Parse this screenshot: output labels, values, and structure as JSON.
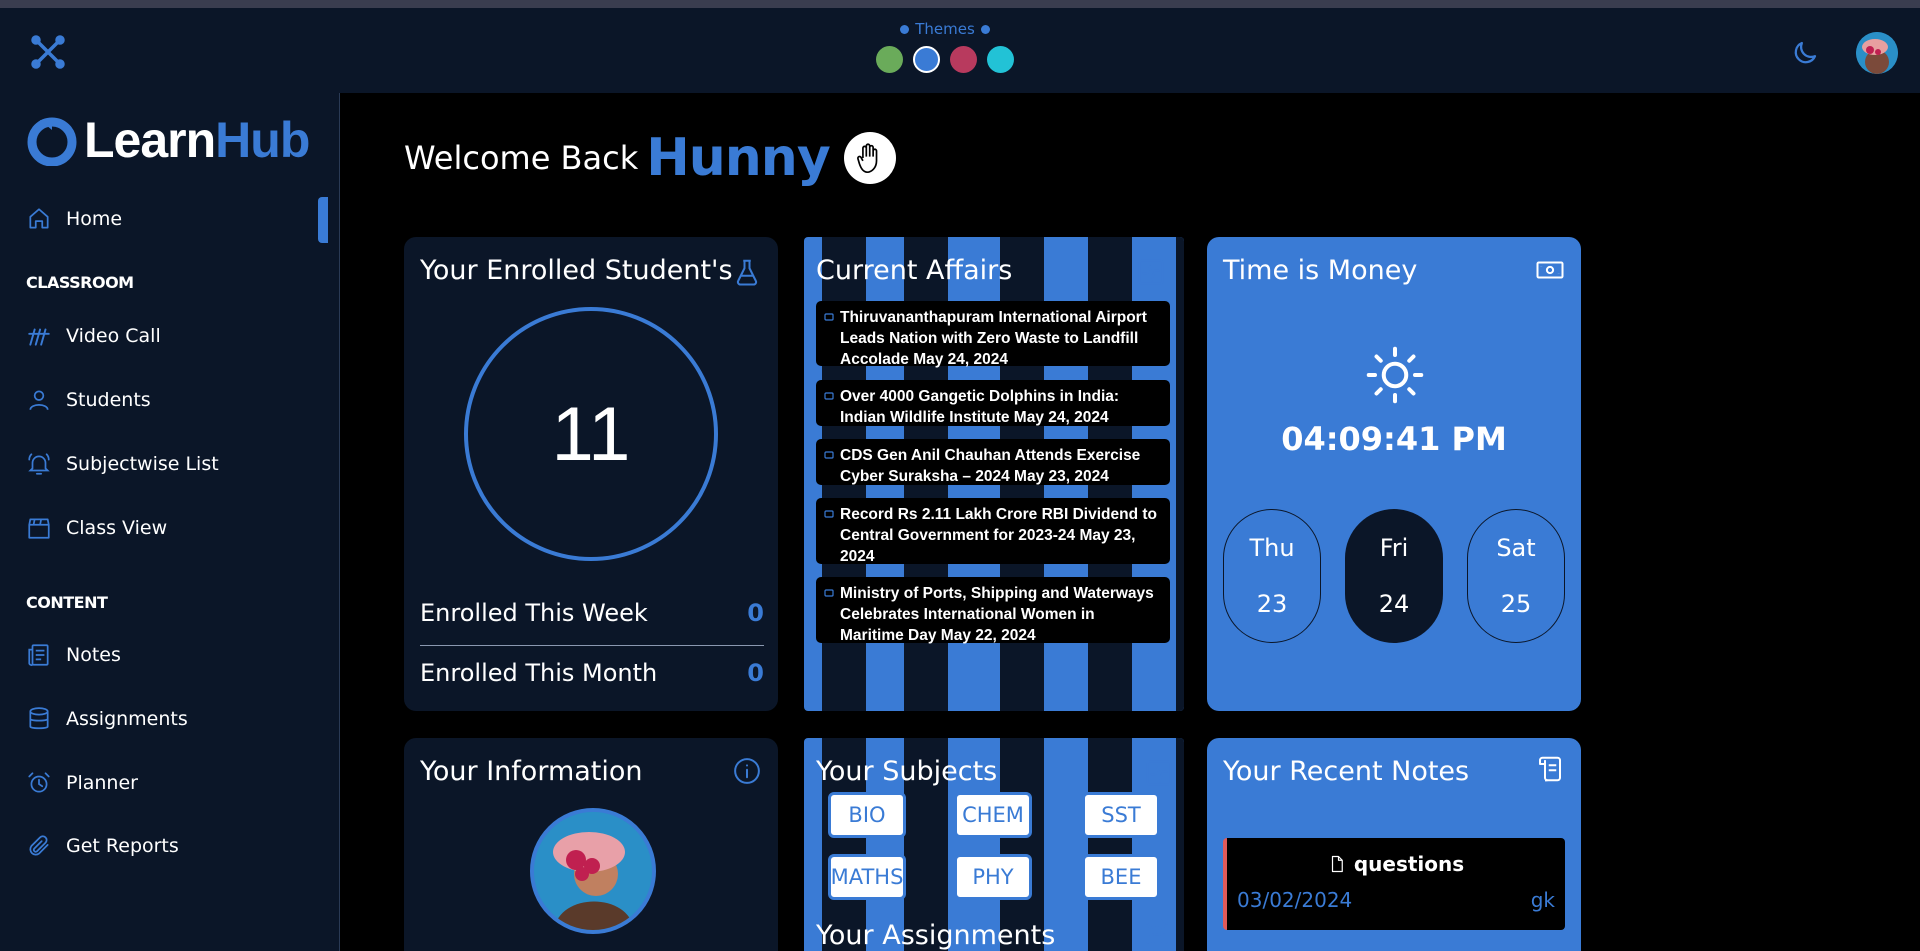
{
  "topbar": {
    "themes_label": "Themes",
    "theme_colors": [
      "#6aab5a",
      "#3a7bd5",
      "#b83a5e",
      "#22c2d6"
    ],
    "active_theme": 1
  },
  "brand": {
    "part1": "Learn",
    "part2": "Hub"
  },
  "sidebar": {
    "home": "Home",
    "classroom_heading": "CLASSROOM",
    "classroom_items": [
      "Video Call",
      "Students",
      "Subjectwise List",
      "Class View"
    ],
    "content_heading": "CONTENT",
    "content_items": [
      "Notes",
      "Assignments",
      "Planner",
      "Get Reports"
    ]
  },
  "welcome": {
    "prefix": "Welcome Back",
    "name": "Hunny"
  },
  "enrolled": {
    "title": "Your Enrolled Student's",
    "total": "11",
    "week_label": "Enrolled This Week",
    "week_value": "0",
    "month_label": "Enrolled This Month",
    "month_value": "0"
  },
  "current_affairs": {
    "title": "Current Affairs",
    "items": [
      "Thiruvananthapuram International Airport Leads Nation with Zero Waste to Landfill Accolade May 24, 2024",
      "Over 4000 Gangetic Dolphins in India: Indian Wildlife Institute May 24, 2024",
      "CDS Gen Anil Chauhan Attends Exercise Cyber Suraksha – 2024 May 23, 2024",
      "Record Rs 2.11 Lakh Crore RBI Dividend to Central Government for 2023-24 May 23, 2024",
      "Ministry of Ports, Shipping and Waterways Celebrates International Women in Maritime Day May 22, 2024"
    ]
  },
  "time_card": {
    "title": "Time is Money",
    "clock": "04:09:41 PM",
    "days": [
      {
        "day": "Thu",
        "date": "23"
      },
      {
        "day": "Fri",
        "date": "24"
      },
      {
        "day": "Sat",
        "date": "25"
      }
    ],
    "active_day": 1
  },
  "info_card": {
    "title": "Your Information"
  },
  "subjects_card": {
    "title": "Your Subjects",
    "subjects": [
      "BIO",
      "CHEM",
      "SST",
      "MATHS",
      "PHY",
      "BEE"
    ],
    "assignments_title": "Your Assignments"
  },
  "notes_card": {
    "title": "Your Recent Notes",
    "notes": [
      {
        "title": "questions",
        "date": "03/02/2024",
        "subject": "gk"
      }
    ]
  }
}
